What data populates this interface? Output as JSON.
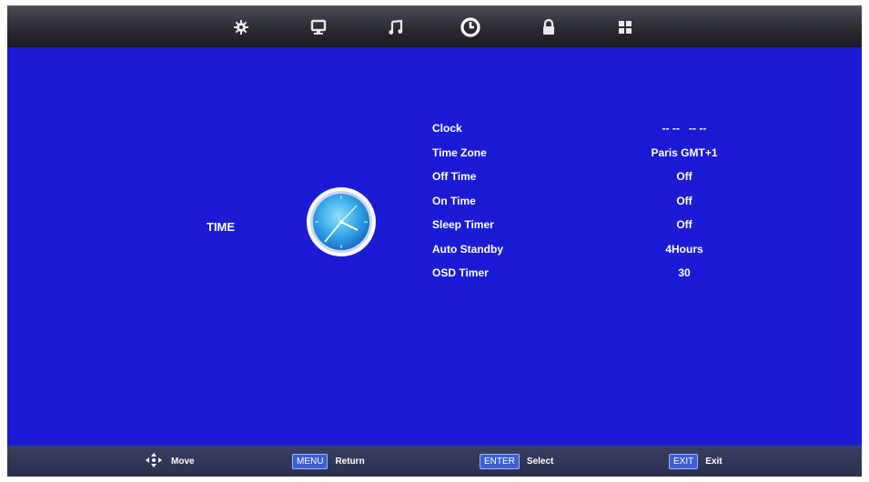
{
  "tabs": [
    {
      "name": "picture",
      "icon": "gear-icon",
      "active": false
    },
    {
      "name": "screen",
      "icon": "monitor-icon",
      "active": false
    },
    {
      "name": "sound",
      "icon": "music-note-icon",
      "active": false
    },
    {
      "name": "time",
      "icon": "clock-icon",
      "active": true
    },
    {
      "name": "lock",
      "icon": "lock-icon",
      "active": false
    },
    {
      "name": "setup",
      "icon": "grid-icon",
      "active": false
    }
  ],
  "section": {
    "title": "TIME",
    "icon": "clock-icon"
  },
  "menu": {
    "items": [
      {
        "label": "Clock",
        "value": "-- --   -- --"
      },
      {
        "label": "Time Zone",
        "value": "Paris GMT+1"
      },
      {
        "label": "Off Time",
        "value": "Off"
      },
      {
        "label": "On Time",
        "value": "Off"
      },
      {
        "label": "Sleep Timer",
        "value": "Off"
      },
      {
        "label": "Auto Standby",
        "value": "4Hours"
      },
      {
        "label": "OSD Timer",
        "value": "30"
      }
    ]
  },
  "footer": {
    "move": {
      "icon": "dpad-icon",
      "label": "Move"
    },
    "return": {
      "key": "MENU",
      "label": "Return"
    },
    "select": {
      "key": "ENTER",
      "label": "Select"
    },
    "exit": {
      "key": "EXIT",
      "label": "Exit"
    }
  },
  "colors": {
    "background": "#1b1bd6",
    "topbar": "#2a2b33",
    "footer": "#2b2f4c",
    "text": "#ffffff"
  }
}
